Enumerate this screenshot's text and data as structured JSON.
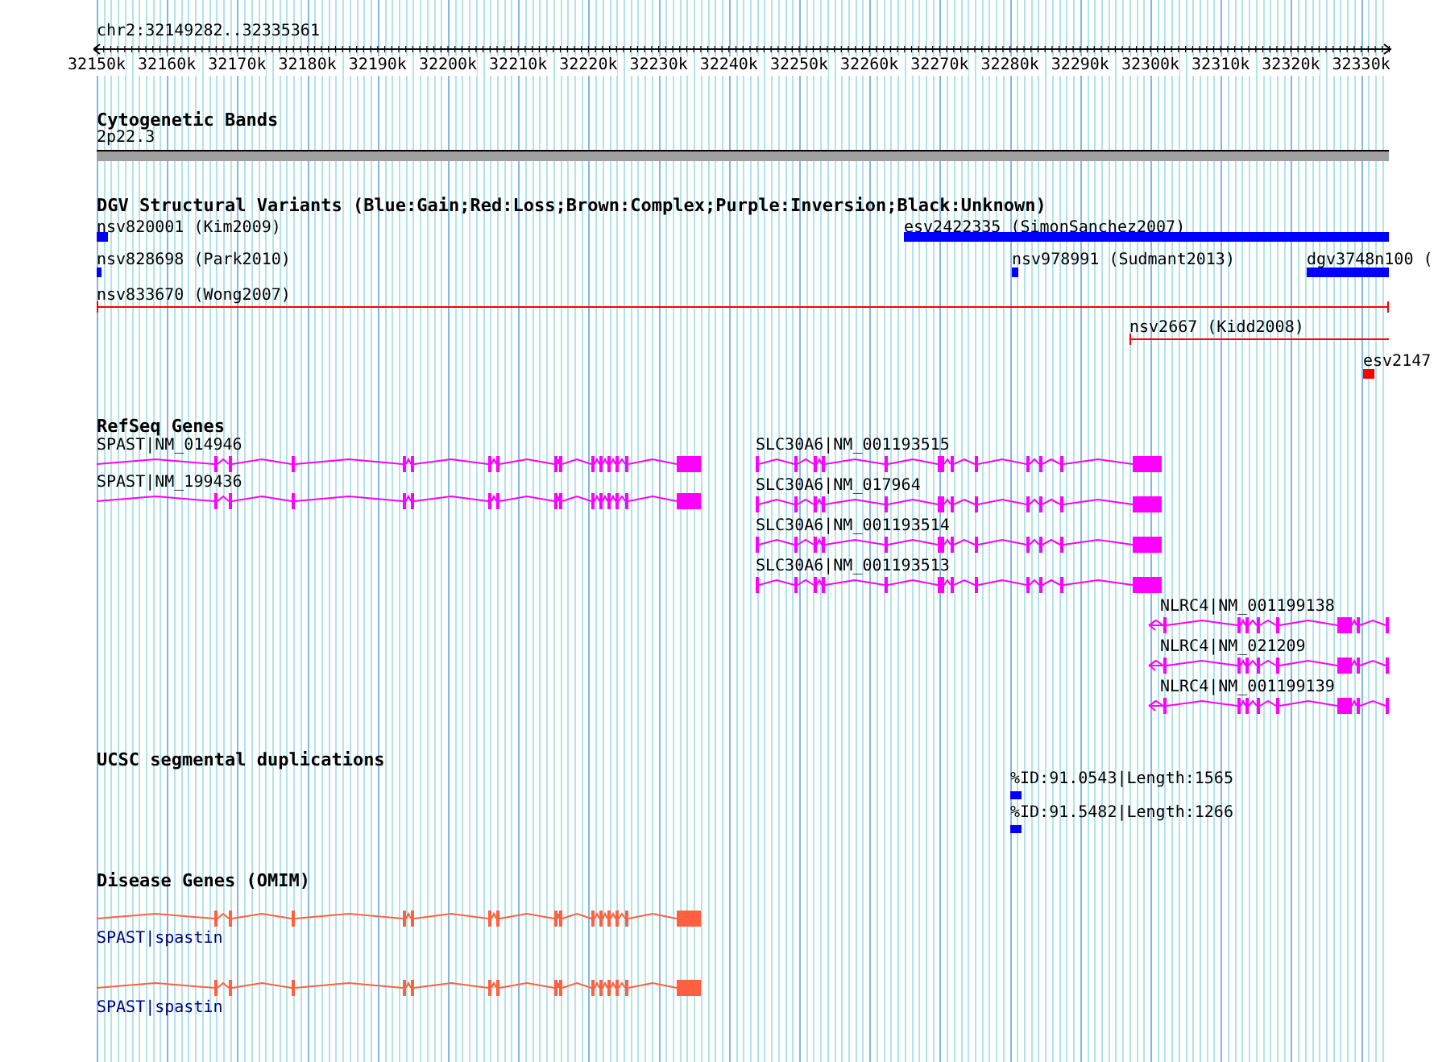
{
  "ruler": {
    "location": "chr2:32149282..32335361",
    "ticks": [
      "32150k",
      "32160k",
      "32170k",
      "32180k",
      "32190k",
      "32200k",
      "32210k",
      "32220k",
      "32230k",
      "32240k",
      "32250k",
      "32260k",
      "32270k",
      "32280k",
      "32290k",
      "32300k",
      "32310k",
      "32320k",
      "32330k"
    ]
  },
  "tracks": [
    {
      "kind": "cytoband",
      "title": "Cytogenetic Bands",
      "band": "2p22.3"
    },
    {
      "kind": "variants",
      "title": "DGV Structural Variants (Blue:Gain;Red:Loss;Brown:Complex;Purple:Inversion;Black:Unknown)",
      "features": [
        {
          "label": "nsv820001 (Kim2009)",
          "kind": "box",
          "color": "#0000ff"
        },
        {
          "label": "esv2422335 (SimonSanchez2007)",
          "kind": "box",
          "color": "#0000ff"
        },
        {
          "label": "nsv828698 (Park2010)",
          "kind": "box",
          "color": "#0000ff"
        },
        {
          "label": "nsv978991 (Sudmant2013)",
          "kind": "box",
          "color": "#0000ff"
        },
        {
          "label": "dgv3748n100 (",
          "kind": "box",
          "color": "#0000ff"
        },
        {
          "label": "nsv833670 (Wong2007)",
          "kind": "span",
          "color": "#ff0000"
        },
        {
          "label": "nsv2667 (Kidd2008)",
          "kind": "span",
          "color": "#ff0000"
        },
        {
          "label": "esv2147",
          "kind": "box",
          "color": "#ff0000"
        }
      ]
    },
    {
      "kind": "genes",
      "title": "RefSeq Genes",
      "features": [
        {
          "label": "SPAST|NM_014946",
          "reverse": false
        },
        {
          "label": "SPAST|NM_199436",
          "reverse": false
        },
        {
          "label": "SLC30A6|NM_001193515",
          "reverse": false
        },
        {
          "label": "SLC30A6|NM_017964",
          "reverse": false
        },
        {
          "label": "SLC30A6|NM_001193514",
          "reverse": false
        },
        {
          "label": "SLC30A6|NM_001193513",
          "reverse": false
        },
        {
          "label": "NLRC4|NM_001199138",
          "reverse": true
        },
        {
          "label": "NLRC4|NM_021209",
          "reverse": true
        },
        {
          "label": "NLRC4|NM_001199139",
          "reverse": true
        }
      ]
    },
    {
      "kind": "segdups",
      "title": "UCSC segmental duplications",
      "features": [
        {
          "label": "%ID:91.0543|Length:1565"
        },
        {
          "label": "%ID:91.5482|Length:1266"
        }
      ]
    },
    {
      "kind": "disease",
      "title": "Disease Genes (OMIM)",
      "features": [
        {
          "label": "SPAST|spastin"
        },
        {
          "label": "SPAST|spastin"
        }
      ]
    }
  ]
}
